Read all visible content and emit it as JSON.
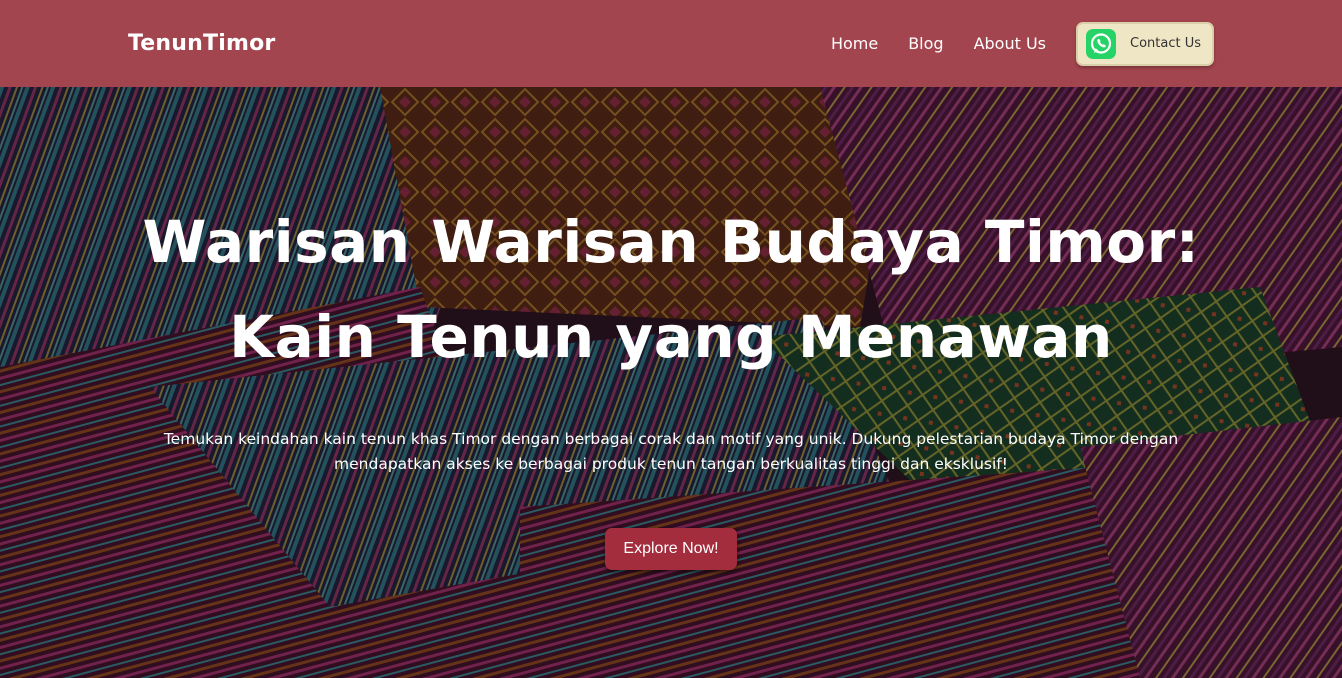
{
  "navbar": {
    "brand": "TenunTimor",
    "links": [
      "Home",
      "Blog",
      "About Us"
    ],
    "contact": {
      "label": "Contact Us",
      "icon": "whatsapp-icon"
    }
  },
  "hero": {
    "title_line1": "Warisan Warisan Budaya Timor:",
    "title_line2": "Kain Tenun yang Menawan",
    "subtitle_line1": "Temukan keindahan kain tenun khas Timor dengan berbagai corak dan motif yang unik. Dukung pelestarian budaya Timor dengan",
    "subtitle_line2": "mendapatkan akses ke berbagai produk tenun tangan berkualitas tinggi dan eksklusif!",
    "cta": "Explore Now!"
  },
  "colors": {
    "navbar": "#a3454f",
    "cta": "#a32c3d",
    "contact_bg": "#efe6c6",
    "whatsapp": "#25d366"
  }
}
